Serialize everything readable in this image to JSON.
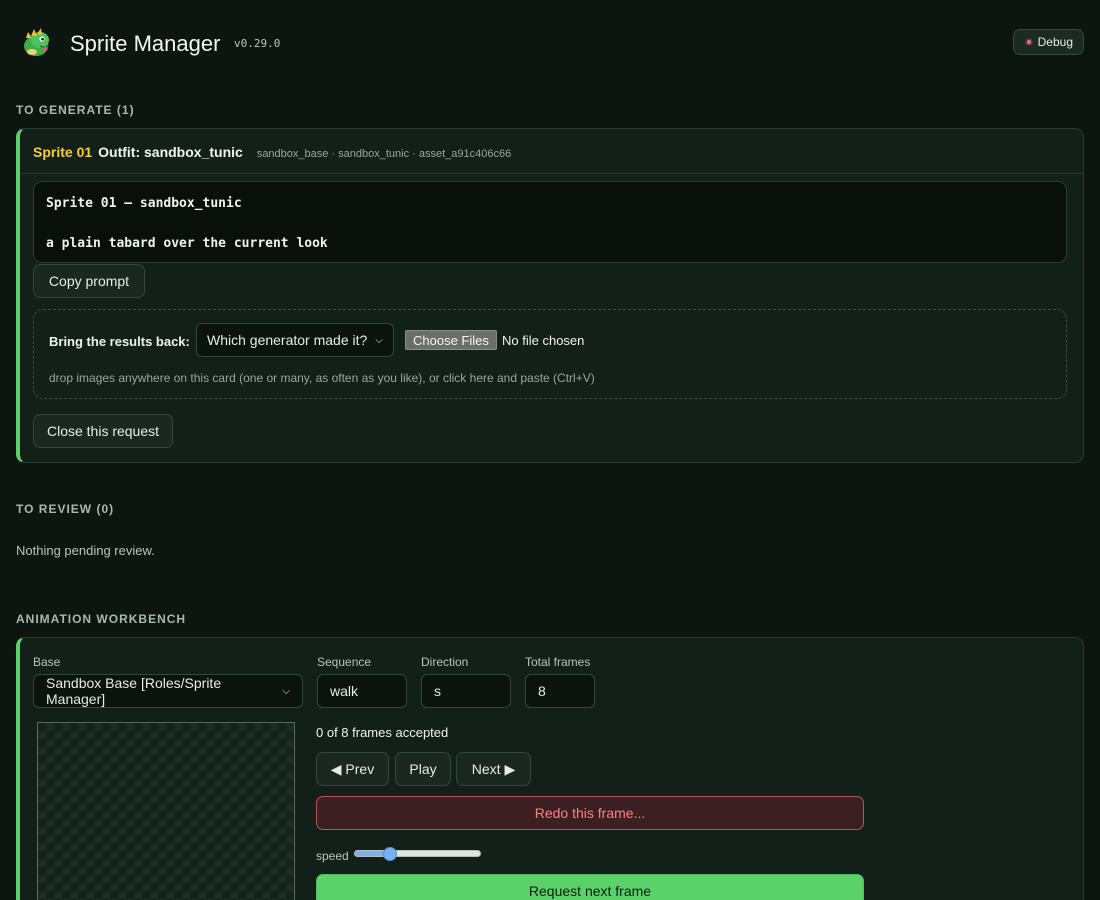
{
  "header": {
    "title": "Sprite Manager",
    "version": "v0.29.0",
    "debug_label": "Debug",
    "logo_icon": "dragon-mascot-icon",
    "debug_icon": "bug-icon"
  },
  "to_generate": {
    "section_title": "TO GENERATE (1)",
    "card": {
      "sprite_num": "Sprite 01",
      "outfit": "Outfit: sandbox_tunic",
      "meta": "sandbox_base · sandbox_tunic · asset_a91c406c66",
      "prompt_line1": "Sprite 01 — sandbox_tunic",
      "prompt_line2": "a plain tabard over the current look",
      "copy_label": "Copy prompt",
      "bring_label": "Bring the results back:",
      "generator_select": "Which generator made it?",
      "choose_files": "Choose Files",
      "no_file": "No file chosen",
      "drop_hint": "drop images anywhere on this card (one or many, as often as you like), or click here and paste (Ctrl+V)",
      "close_label": "Close this request"
    }
  },
  "to_review": {
    "section_title": "TO REVIEW (0)",
    "empty_text": "Nothing pending review."
  },
  "workbench": {
    "section_title": "ANIMATION WORKBENCH",
    "base_label": "Base",
    "base_value": "Sandbox Base [Roles/Sprite Manager]",
    "sequence_label": "Sequence",
    "sequence_value": "walk",
    "direction_label": "Direction",
    "direction_value": "s",
    "total_frames_label": "Total frames",
    "total_frames_value": "8",
    "frames_status": "0 of 8 frames accepted",
    "prev_label": "◀ Prev",
    "play_label": "Play",
    "next_label": "Next ▶",
    "redo_label": "Redo this frame...",
    "speed_label": "speed",
    "speed_fraction": 0.25,
    "request_label": "Request next frame"
  },
  "colors": {
    "accent_green": "#5bd16a",
    "sprite_yellow": "#f5cc3d",
    "redo_red": "#ff7f84",
    "slider_blue": "#7ab0f0"
  }
}
